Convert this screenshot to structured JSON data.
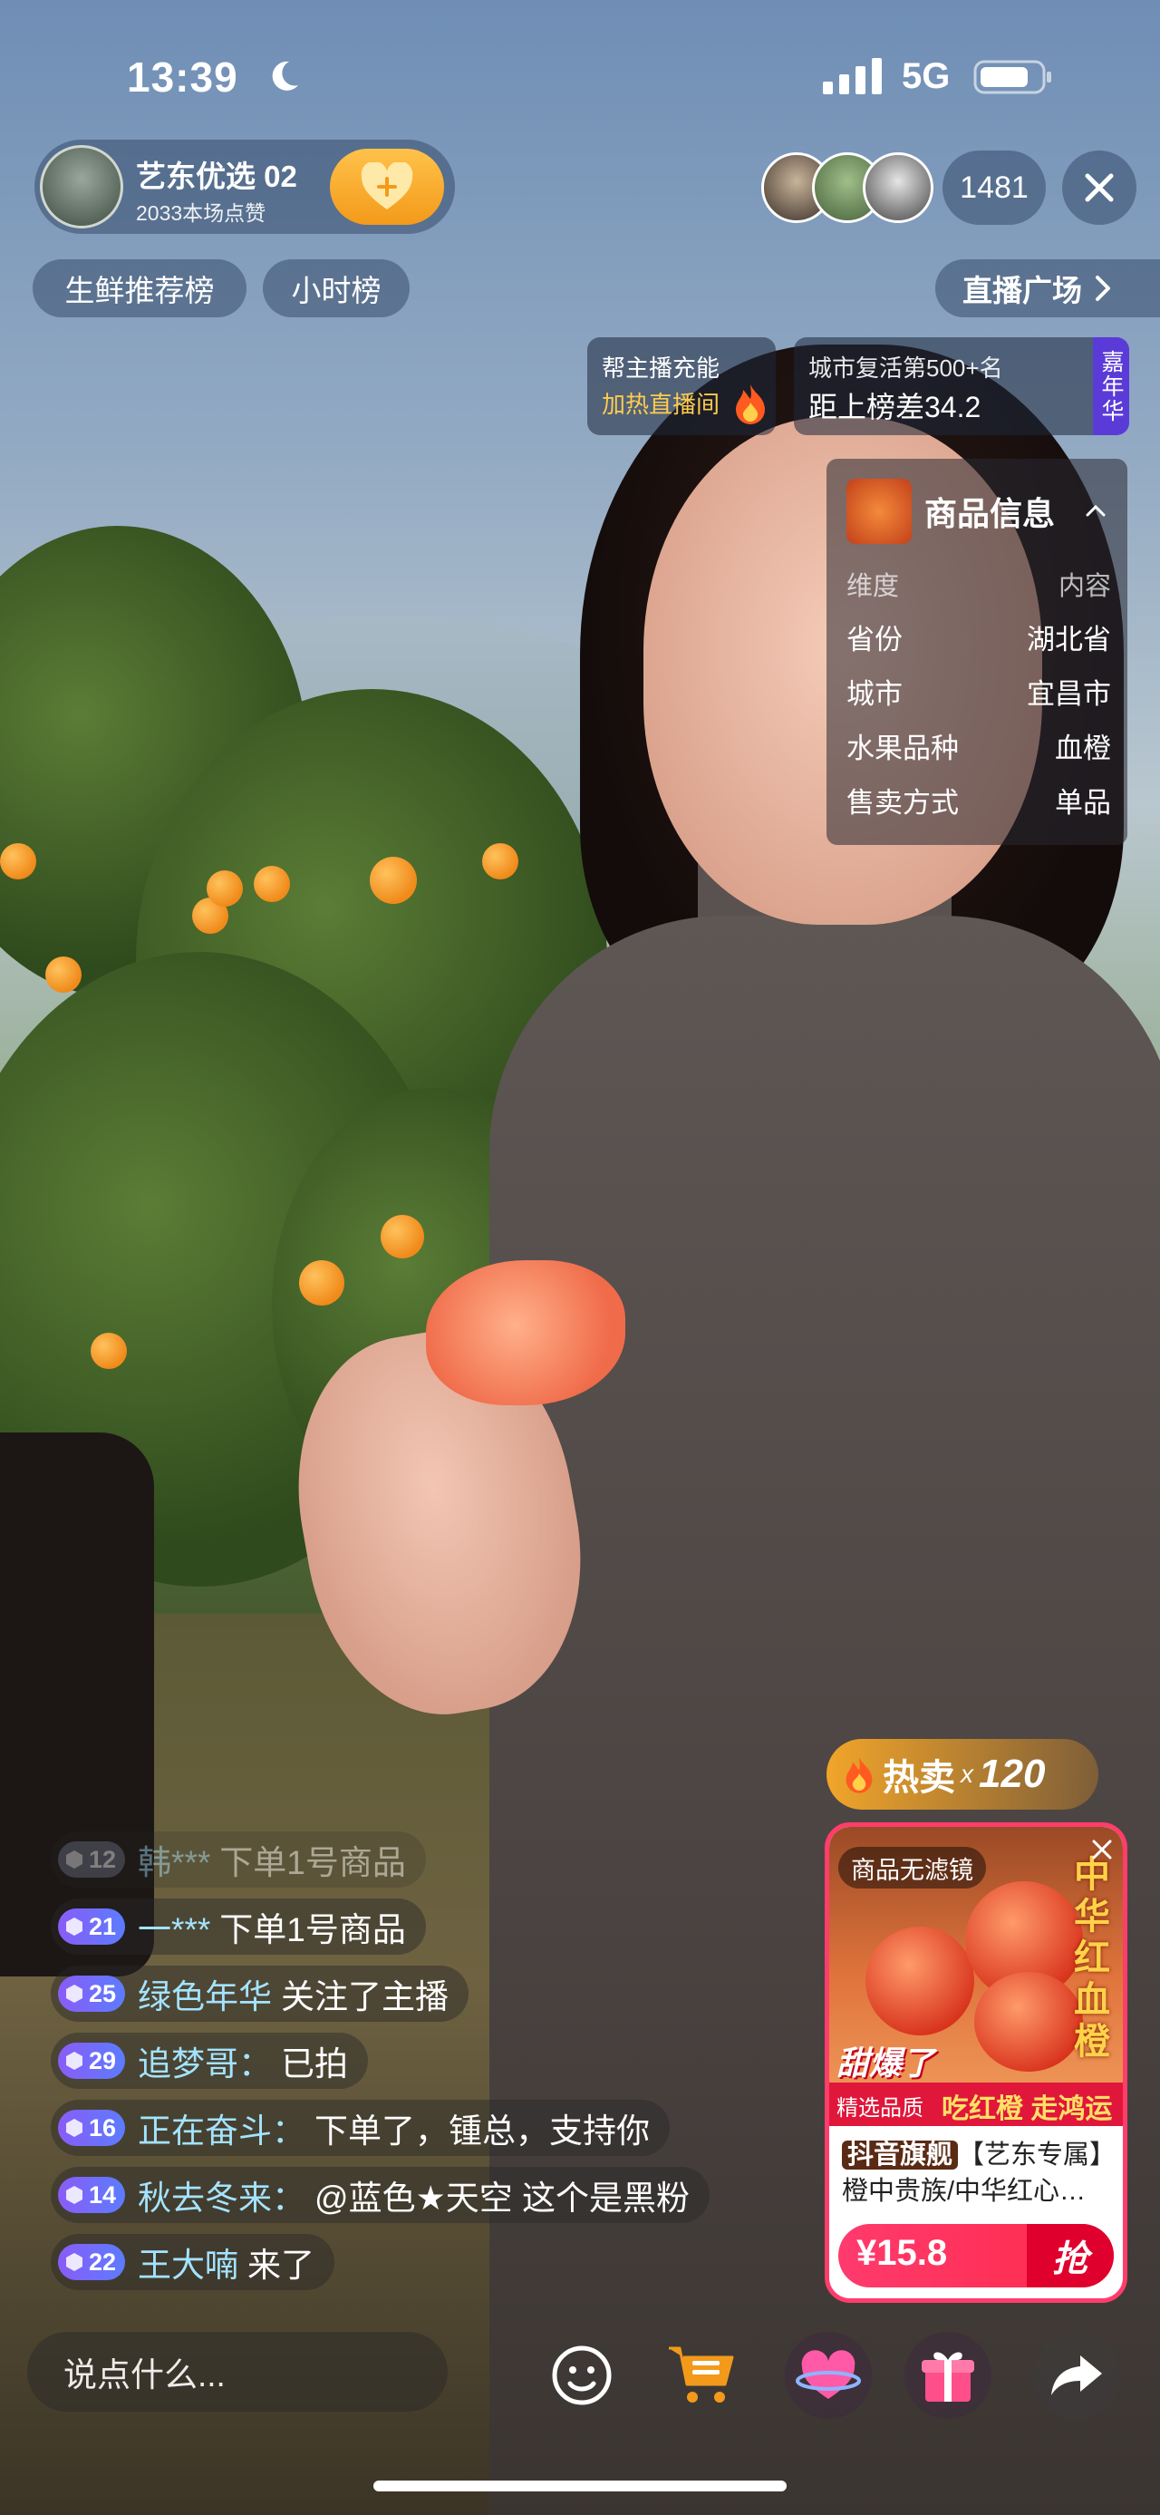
{
  "status_bar": {
    "time": "13:39",
    "network": "5G"
  },
  "host": {
    "name": "艺东优选 02",
    "likes": "2033本场点赞"
  },
  "viewers": {
    "count": "1481"
  },
  "tags": [
    "生鲜推荐榜",
    "小时榜"
  ],
  "plaza_label": "直播广场",
  "boost": {
    "line1": "帮主播充能",
    "line2": "加热直播间"
  },
  "rank": {
    "line1": "城市复活第500+名",
    "line2": "距上榜差34.2",
    "badge": "嘉年华"
  },
  "product_info": {
    "title": "商品信息",
    "header": {
      "key": "维度",
      "value": "内容"
    },
    "rows": [
      {
        "key": "省份",
        "value": "湖北省"
      },
      {
        "key": "城市",
        "value": "宜昌市"
      },
      {
        "key": "水果品种",
        "value": "血橙"
      },
      {
        "key": "售卖方式",
        "value": "单品"
      }
    ]
  },
  "comments": [
    {
      "level": "12",
      "user": "韩***",
      "text": "下单1号商品"
    },
    {
      "level": "21",
      "user": "一***",
      "text": "下单1号商品"
    },
    {
      "level": "25",
      "user": "绿色年华",
      "text": "关注了主播"
    },
    {
      "level": "29",
      "user": "追梦哥：",
      "text": "已拍"
    },
    {
      "level": "16",
      "user": "正在奋斗：",
      "text": "下单了，锺总，支持你"
    },
    {
      "level": "14",
      "user": "秋去冬来：",
      "text": "@蓝色★天空 这个是黑粉"
    },
    {
      "level": "22",
      "user": "王大喃",
      "text": "来了"
    }
  ],
  "hot": {
    "label": "热卖",
    "x": "x",
    "count": "120"
  },
  "product_card": {
    "no_filter": "商品无滤镜",
    "vertical_text": "中华红血橙",
    "boom": "甜爆了",
    "strip_small": "精选品质",
    "strip_big": "吃红橙 走鸿运",
    "shop_tag": "抖音旗舰",
    "description": "【艺东专属】橙中贵族/中华红心…",
    "price": "¥15.8",
    "grab": "抢"
  },
  "input": {
    "placeholder": "说点什么..."
  },
  "colors": {
    "accent": "#ff3d6b",
    "gold": "#f7a823",
    "level_badge": "#6d6cf5",
    "username": "#a4e3ff"
  }
}
